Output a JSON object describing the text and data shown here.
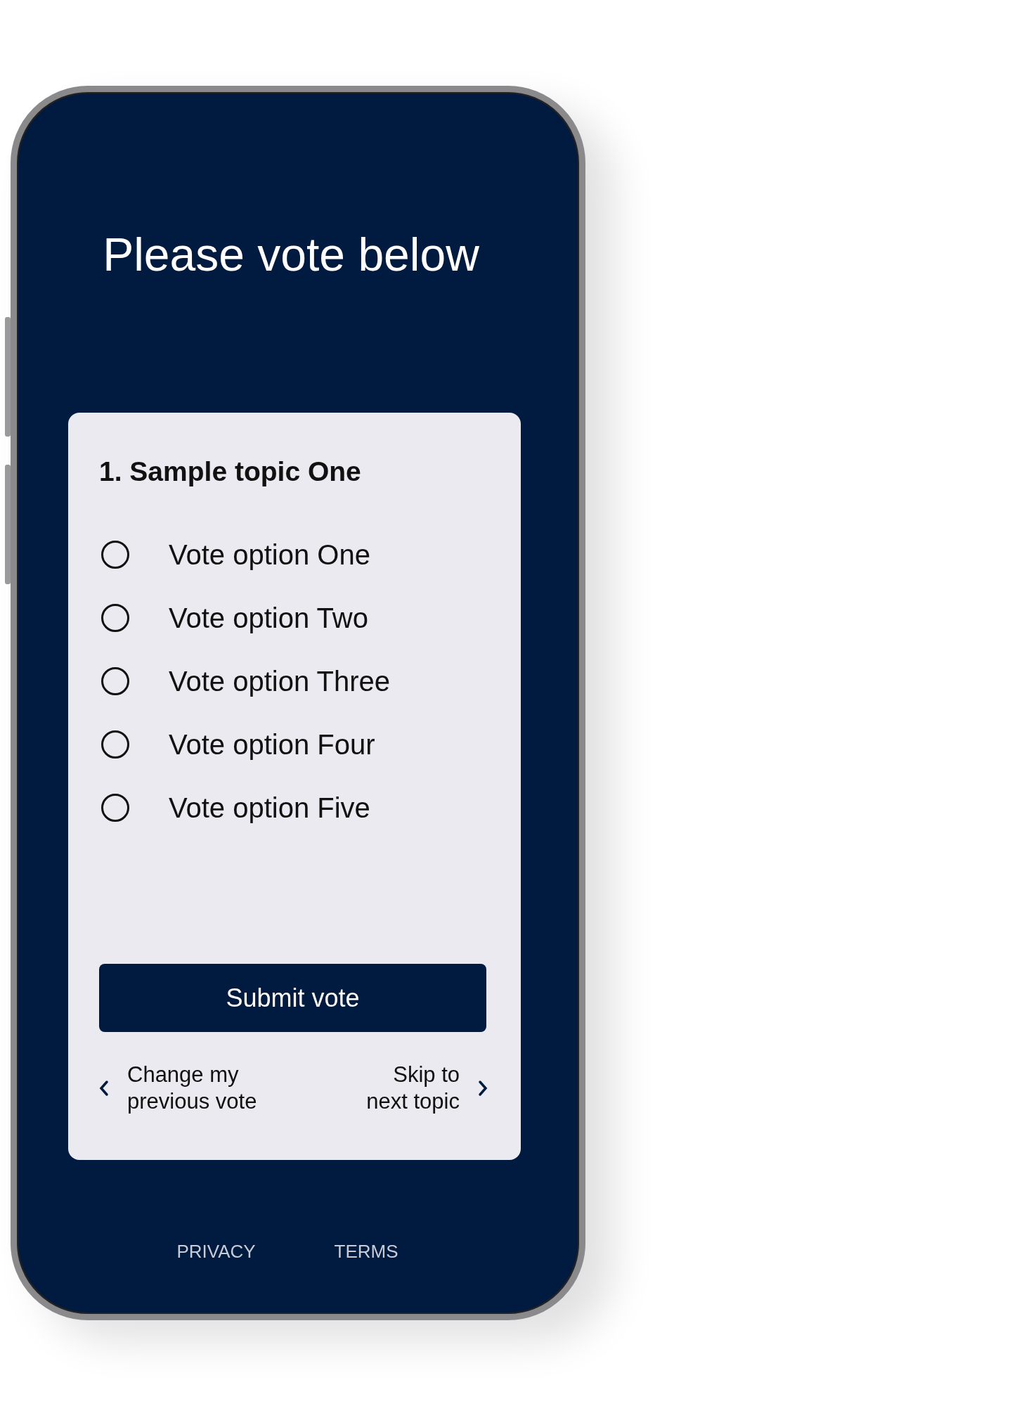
{
  "title": "Please vote below",
  "topic": {
    "title": "1. Sample topic One",
    "options": [
      {
        "label": "Vote option One",
        "selected": false
      },
      {
        "label": "Vote option Two",
        "selected": false
      },
      {
        "label": "Vote option Three",
        "selected": false
      },
      {
        "label": "Vote option Four",
        "selected": false
      },
      {
        "label": "Vote option Five",
        "selected": false
      }
    ],
    "submit_button": "Submit vote",
    "previous_link": {
      "lines": [
        "Change my",
        "previous vote"
      ]
    },
    "next_link": {
      "lines": [
        "Skip to",
        "next topic"
      ]
    }
  },
  "footer_links": [
    "PRIVACY",
    "TERMS"
  ]
}
